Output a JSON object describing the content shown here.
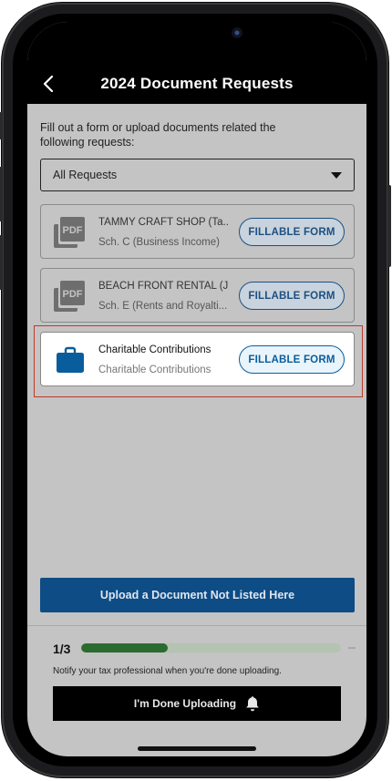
{
  "header": {
    "title": "2024 Document Requests",
    "back_icon": "chevron-left-icon"
  },
  "intro": {
    "text": "Fill out a form or upload documents related the following requests:"
  },
  "filter": {
    "selected": "All Requests",
    "icon": "caret-down-icon"
  },
  "requests": [
    {
      "title": "TAMMY CRAFT SHOP (Ta...",
      "subtitle": "Sch. C (Business Income)",
      "icon": "pdf-icon",
      "button": "FILLABLE FORM"
    },
    {
      "title": "BEACH FRONT RENTAL  (J...",
      "subtitle": "Sch. E (Rents and Royalti...",
      "icon": "pdf-icon",
      "button": "FILLABLE FORM"
    },
    {
      "title": "Charitable Contributions",
      "subtitle": "Charitable Contributions",
      "icon": "briefcase-icon",
      "button": "FILLABLE FORM"
    }
  ],
  "upload": {
    "label": "Upload a Document Not Listed Here"
  },
  "progress": {
    "label": "1/3",
    "fraction": 0.333,
    "note": "Notify your tax professional when you're done uploading."
  },
  "done": {
    "label": "I'm Done Uploading",
    "icon": "bell-icon"
  },
  "colors": {
    "accent_blue": "#0e4c85",
    "button_text_active": "#0a5d9c",
    "progress_green": "#2b6b2f",
    "highlight_red": "#c0392b",
    "overlay_gray": "#c4c4c4"
  }
}
